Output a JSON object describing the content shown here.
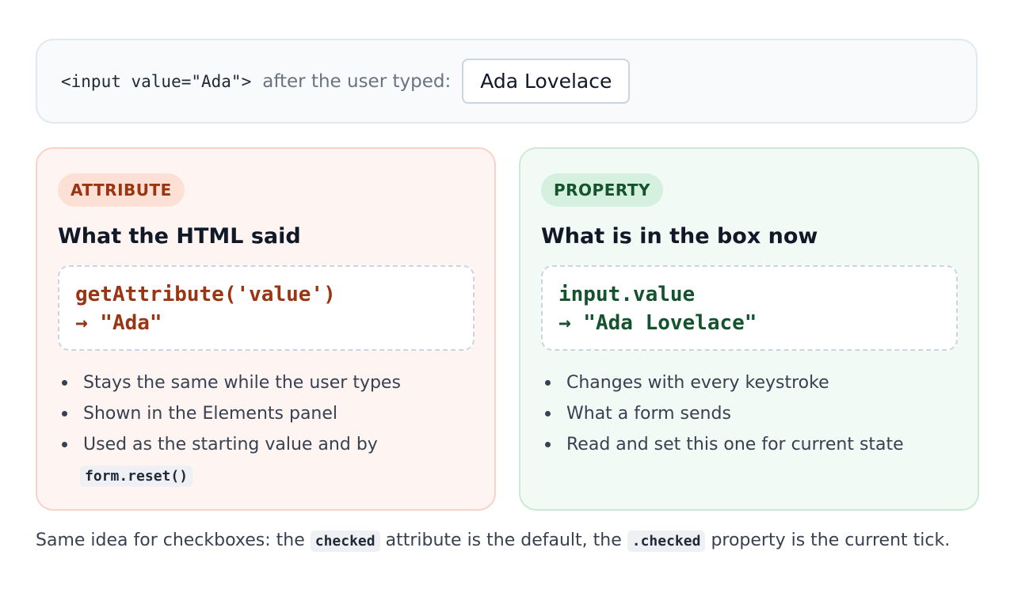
{
  "demo": {
    "code": "<input value=\"Ada\">",
    "caption": "after the user typed:",
    "input_value": "Ada Lovelace"
  },
  "attribute_card": {
    "badge": "ATTRIBUTE",
    "heading": "What the HTML said",
    "code_line1": "getAttribute('value')",
    "code_line2": "→ \"Ada\"",
    "bullets": [
      "Stays the same while the user types",
      "Shown in the Elements panel",
      "Used as the starting value and by"
    ],
    "bullet3_code": "form.reset()",
    "accent_color": "#9a3412"
  },
  "property_card": {
    "badge": "PROPERTY",
    "heading": "What is in the box now",
    "code_line1": "input.value",
    "code_line2": "→ \"Ada Lovelace\"",
    "bullets": [
      "Changes with every keystroke",
      "What a form sends",
      "Read and set this one for current state"
    ],
    "accent_color": "#14532d"
  },
  "footer": {
    "text1": "Same idea for checkboxes: the",
    "code1": "checked",
    "text2": "attribute is the default, the",
    "code2": ".checked",
    "text3": "property is the current tick."
  }
}
